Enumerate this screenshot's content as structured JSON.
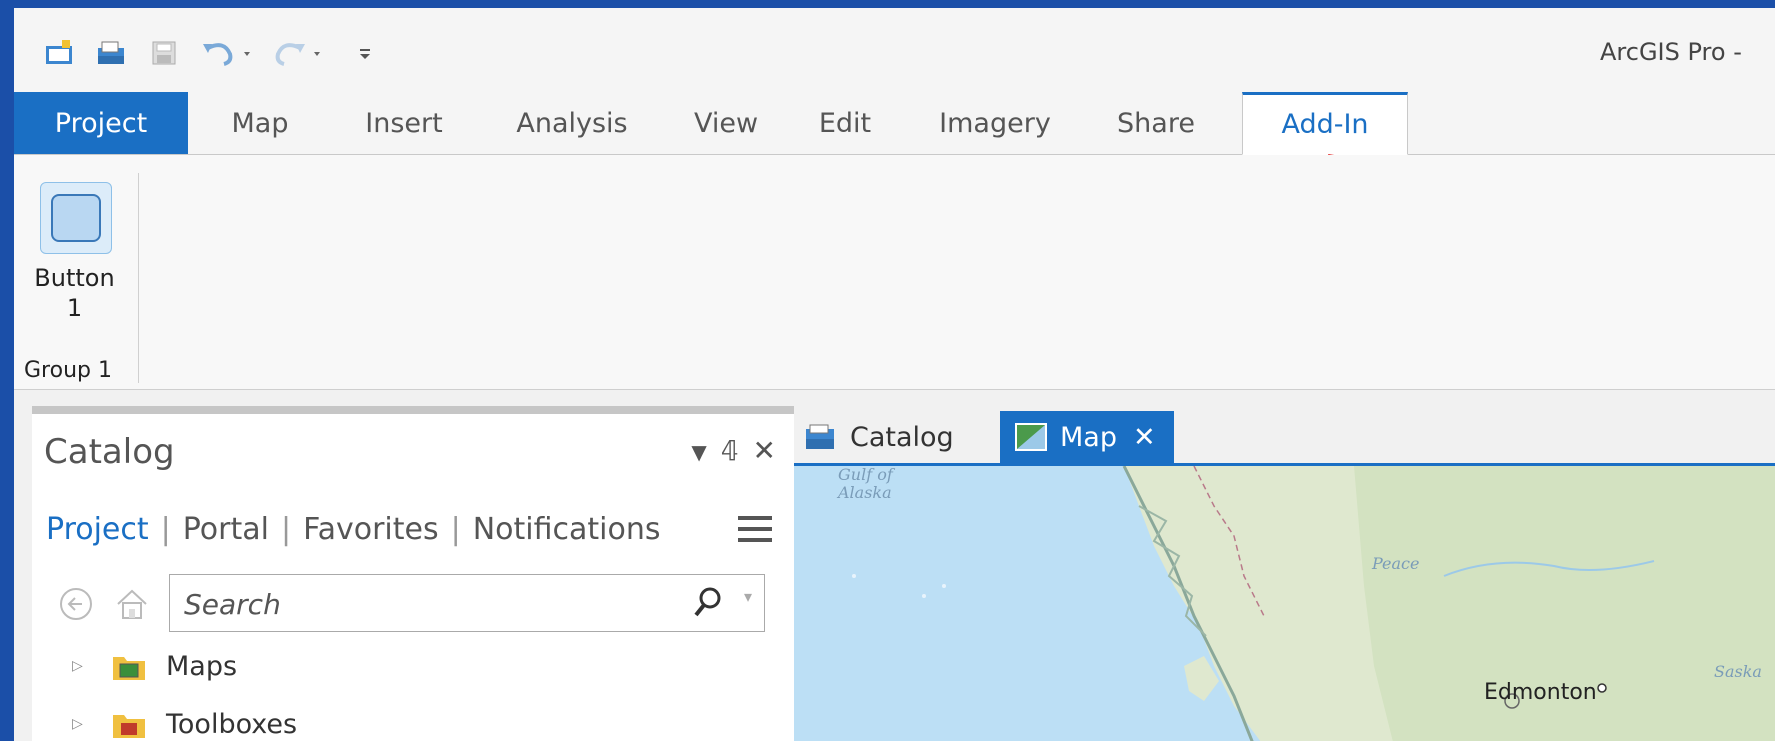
{
  "window": {
    "title": "ArcGIS Pro - "
  },
  "ribbon_tabs": [
    {
      "label": "Project"
    },
    {
      "label": "Map"
    },
    {
      "label": "Insert"
    },
    {
      "label": "Analysis"
    },
    {
      "label": "View"
    },
    {
      "label": "Edit"
    },
    {
      "label": "Imagery"
    },
    {
      "label": "Share"
    },
    {
      "label": "Add-In"
    }
  ],
  "ribbon": {
    "button_label": "Button\n1",
    "group_label": "Group 1"
  },
  "catalog_pane": {
    "title": "Catalog",
    "tabs": [
      {
        "label": "Project"
      },
      {
        "label": "Portal"
      },
      {
        "label": "Favorites"
      },
      {
        "label": "Notifications"
      }
    ],
    "search_placeholder": "Search",
    "items": [
      {
        "label": "Maps"
      },
      {
        "label": "Toolboxes"
      }
    ]
  },
  "view_tabs": [
    {
      "label": "Catalog"
    },
    {
      "label": "Map"
    }
  ],
  "map": {
    "labels": {
      "gulf": "Gulf of\nAlaska",
      "peace": "Peace",
      "city": "Edmonton",
      "sask": "Saska"
    }
  },
  "colors": {
    "accent": "#1a6fc4",
    "frame": "#1b4fa8",
    "arrow": "#e02020"
  }
}
